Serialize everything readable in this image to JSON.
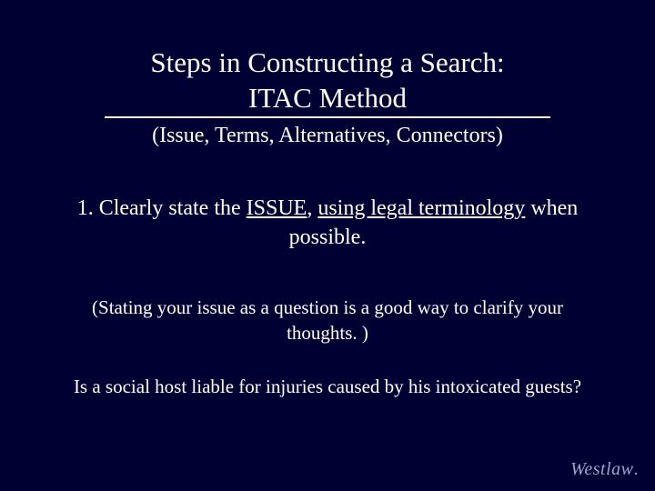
{
  "title_line1": "Steps in Constructing a Search:",
  "title_line2": "ITAC Method",
  "subtitle": "(Issue, Terms, Alternatives, Connectors)",
  "step_prefix": "1.   Clearly state the ",
  "step_issue": "ISSUE",
  "step_comma": ", ",
  "step_underline": "using legal terminology",
  "step_tail": " when possible.",
  "note": "(Stating your issue as a question is a good way to clarify your thoughts. )",
  "example": "Is a social host liable for injuries caused by his intoxicated guests?",
  "logo_text": "Westlaw",
  "logo_dot": "."
}
